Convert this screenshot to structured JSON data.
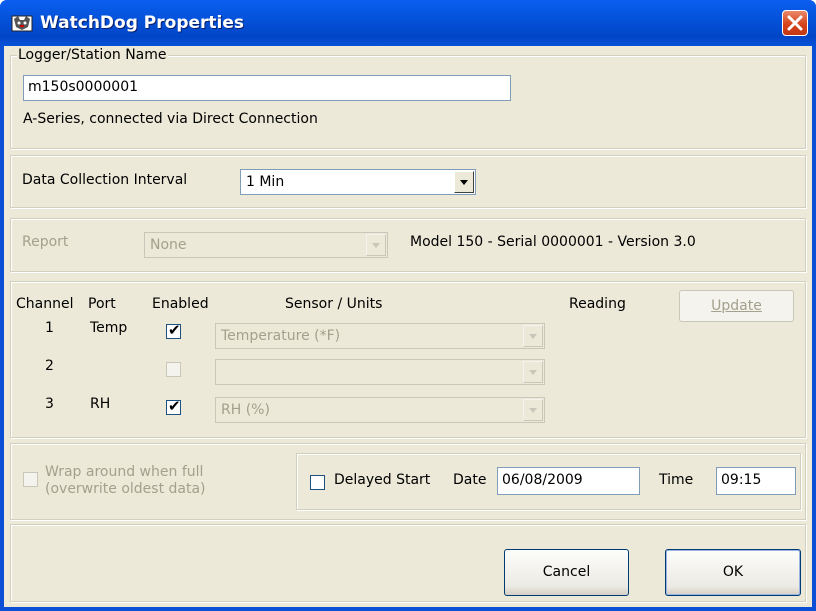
{
  "window": {
    "title": "WatchDog Properties"
  },
  "logger": {
    "legend": "Logger/Station Name",
    "name_value": "m150s0000001",
    "connection_text": "A-Series, connected via Direct Connection"
  },
  "interval": {
    "label": "Data Collection Interval",
    "selected": "1 Min"
  },
  "report": {
    "label": "Report",
    "selected": "None",
    "model_info": "Model 150 - Serial 0000001 - Version 3.0"
  },
  "channels": {
    "headers": {
      "channel": "Channel",
      "port": "Port",
      "enabled": "Enabled",
      "sensor": "Sensor / Units",
      "reading": "Reading"
    },
    "update_label": "Update",
    "rows": [
      {
        "channel": "1",
        "port": "Temp",
        "enabled": true,
        "sensor": "Temperature (*F)"
      },
      {
        "channel": "2",
        "port": "",
        "enabled": false,
        "sensor": ""
      },
      {
        "channel": "3",
        "port": "RH",
        "enabled": true,
        "sensor": "RH (%)"
      }
    ]
  },
  "options": {
    "wrap_label_line1": "Wrap around when full",
    "wrap_label_line2": "(overwrite oldest data)",
    "delayed_start_label": "Delayed Start",
    "date_label": "Date",
    "date_value": "06/08/2009",
    "time_label": "Time",
    "time_value": "09:15"
  },
  "buttons": {
    "cancel": "Cancel",
    "ok": "OK"
  },
  "colors": {
    "titlebar": "#0451d8",
    "close_button": "#d6431c",
    "dialog_bg": "#ece9d8"
  }
}
